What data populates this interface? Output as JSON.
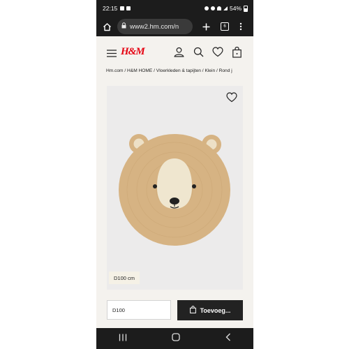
{
  "status_bar": {
    "time": "22:15",
    "battery": "54%"
  },
  "browser": {
    "url": "www2.hm.com/n",
    "tab_count": "6"
  },
  "site": {
    "logo": "H&M"
  },
  "breadcrumb": "Hm.com / H&M HOME / Vloerkleden & tapijten / Klein / Rond j",
  "product": {
    "size_tag": "D100 cm",
    "selected_size": "D100",
    "add_button_label": "Toevoeg..."
  },
  "colors": {
    "brand_red": "#e50010",
    "jute": "#d6b383",
    "dark": "#1c1c1c"
  },
  "icons": [
    "home-icon",
    "lock-icon",
    "plus-icon",
    "tabs-icon",
    "more-icon",
    "menu-icon",
    "account-icon",
    "search-icon",
    "heart-icon",
    "bag-icon",
    "recent-apps-icon",
    "home-nav-icon",
    "back-nav-icon"
  ]
}
